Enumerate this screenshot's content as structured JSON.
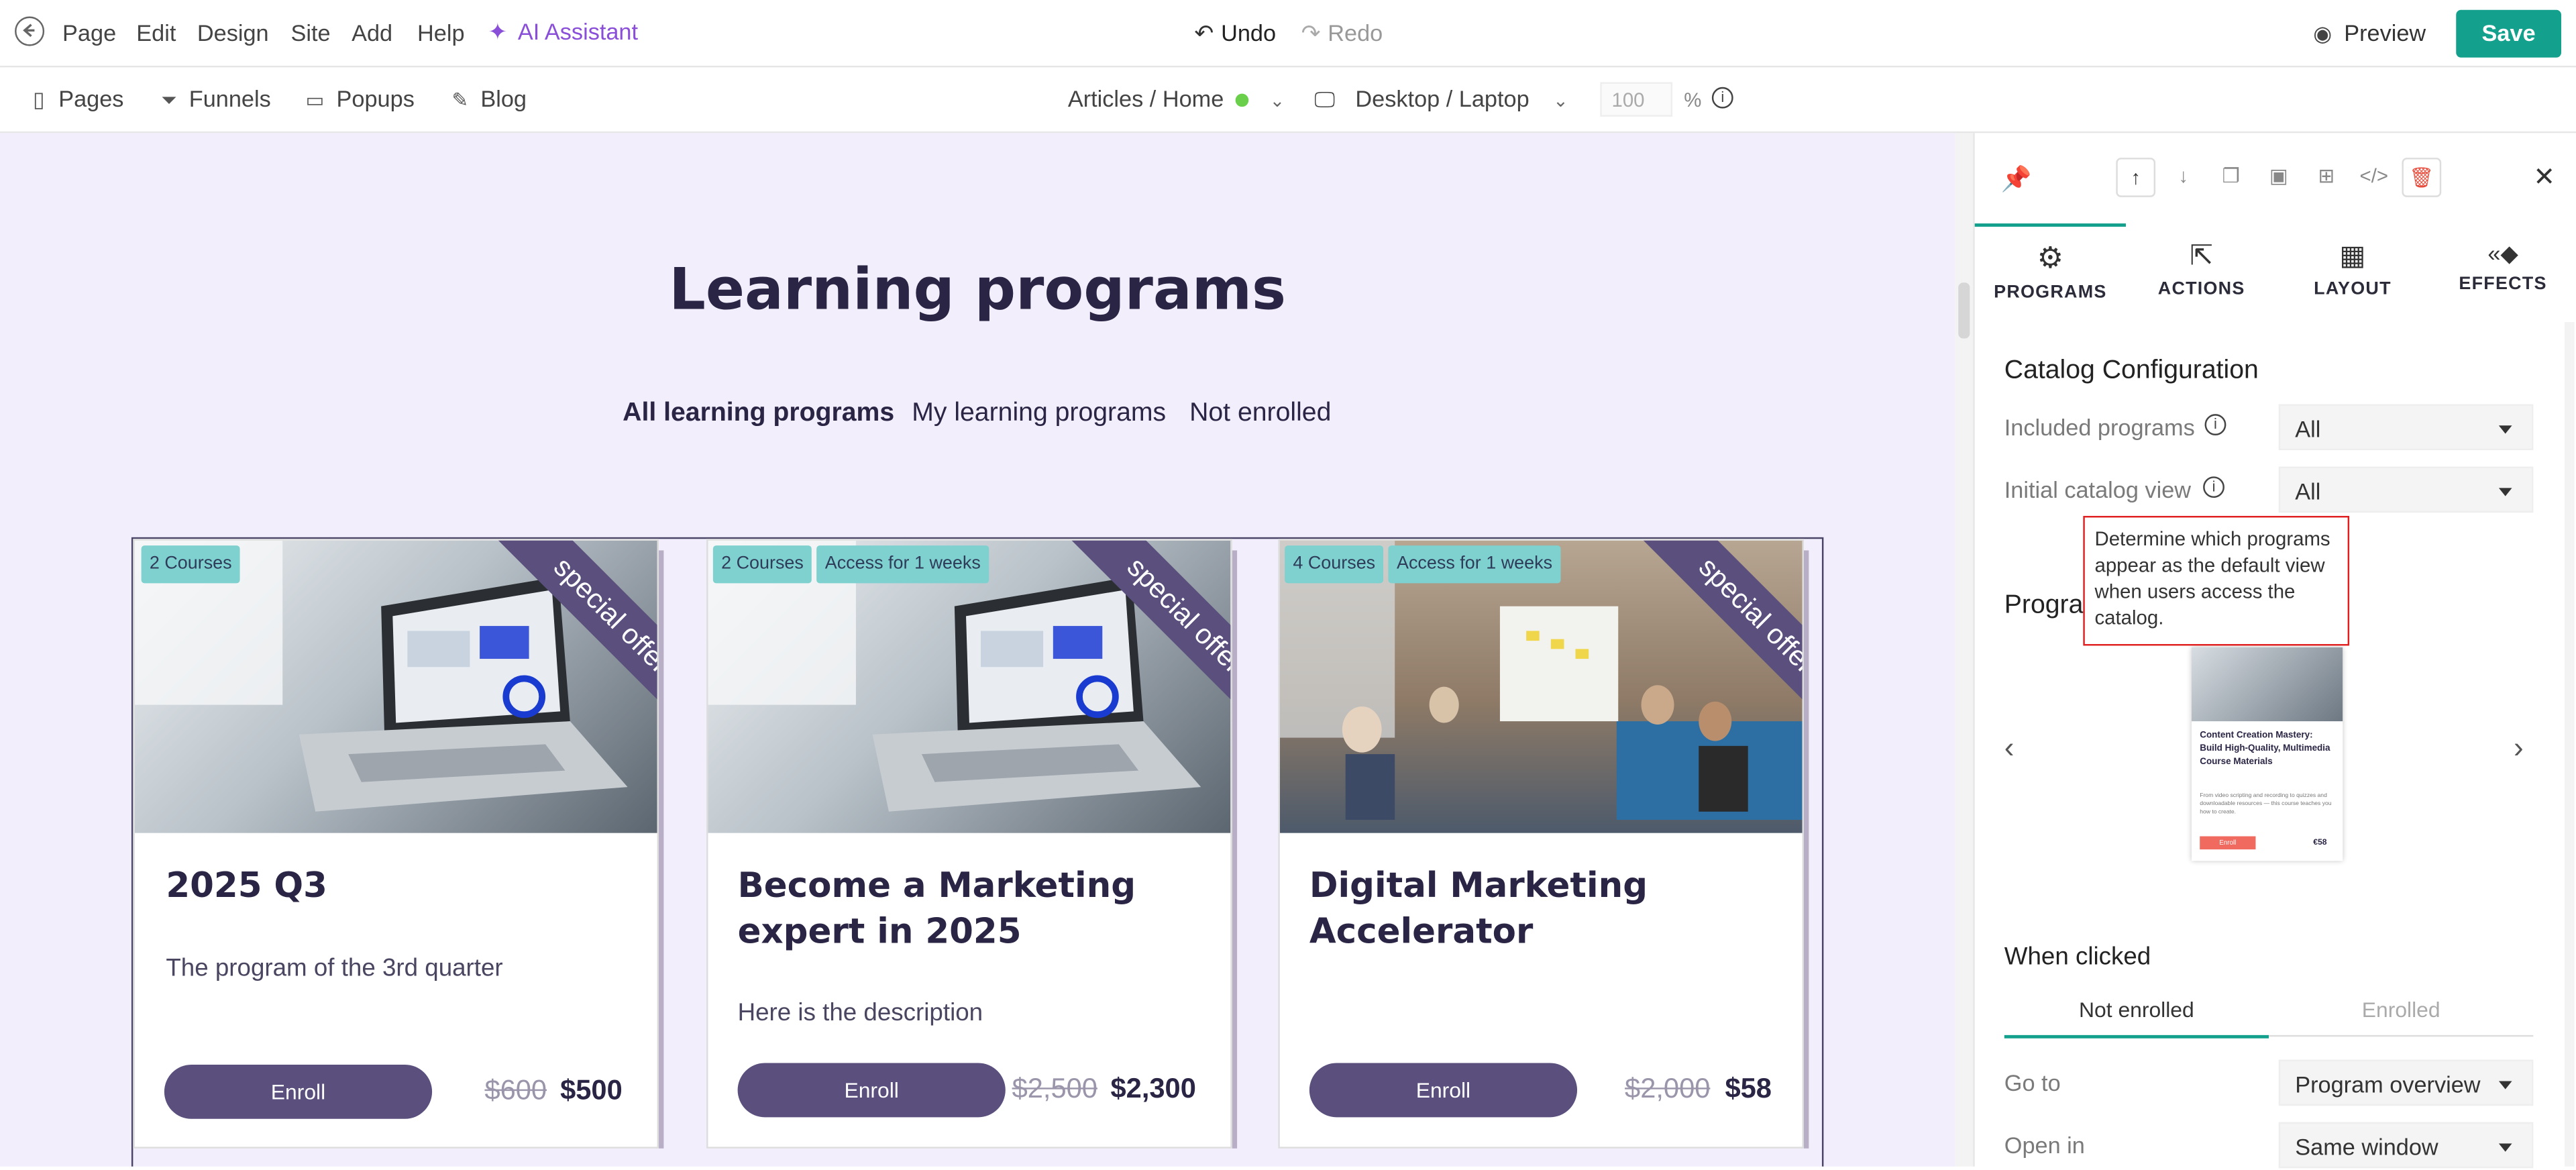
{
  "topbar": {
    "menu": [
      "Page",
      "Edit",
      "Design",
      "Site",
      "Add",
      "Help"
    ],
    "ai_assistant": "AI Assistant",
    "undo": "Undo",
    "redo": "Redo",
    "preview": "Preview",
    "save": "Save"
  },
  "subbar": {
    "pages": "Pages",
    "funnels": "Funnels",
    "popups": "Popups",
    "blog": "Blog",
    "page_selector": "Articles / Home",
    "device": "Desktop / Laptop",
    "zoom": "100",
    "zoom_unit": "%"
  },
  "canvas": {
    "heading": "Learning programs",
    "filters": [
      "All learning programs",
      "My learning programs",
      "Not enrolled"
    ],
    "cards": [
      {
        "tags": [
          "2 Courses"
        ],
        "ribbon": "special offer",
        "title": "2025 Q3",
        "description": "The program of the 3rd quarter",
        "button": "Enroll",
        "old_price": "$600",
        "new_price": "$500"
      },
      {
        "tags": [
          "2 Courses",
          "Access for 1 weeks"
        ],
        "ribbon": "special offer",
        "title": "Become a Marketing expert in 2025",
        "description": "Here is the description",
        "button": "Enroll",
        "old_price": "$2,500",
        "new_price": "$2,300"
      },
      {
        "tags": [
          "4 Courses",
          "Access for 1 weeks"
        ],
        "ribbon": "special offer",
        "title": "Digital Marketing Accelerator",
        "description": "",
        "button": "Enroll",
        "old_price": "$2,000",
        "new_price": "$58"
      }
    ]
  },
  "panel": {
    "tabs": [
      "PROGRAMS",
      "ACTIONS",
      "LAYOUT",
      "EFFECTS"
    ],
    "active_tab": "PROGRAMS",
    "catalog_title": "Catalog Configuration",
    "included_label": "Included programs",
    "included_value": "All",
    "initial_view_label": "Initial catalog view",
    "initial_view_value": "All",
    "tooltip": "Determine which programs appear as the default view when users access the catalog.",
    "programs_title_partial": "Progra",
    "thumbnail": {
      "title": "Content Creation Mastery: Build High-Quality, Multimedia Course Materials",
      "description": "From video scripting and recording to quizzes and downloadable resources — this course teaches you how to create.",
      "button": "Enroll",
      "price": "€58"
    },
    "when_clicked_title": "When clicked",
    "when_clicked_tabs": [
      "Not enrolled",
      "Enrolled"
    ],
    "goto_label": "Go to",
    "goto_value": "Program overview",
    "open_in_label": "Open in",
    "open_in_value": "Same window"
  },
  "colors": {
    "accent": "#13a08c",
    "ai_purple": "#8a4fd8",
    "ribbon": "#5a4f7d",
    "tag": "#7fd1cf",
    "canvas_bg": "#f2eefc",
    "tooltip_border": "#e02020",
    "delete_red": "#e74c3c"
  }
}
